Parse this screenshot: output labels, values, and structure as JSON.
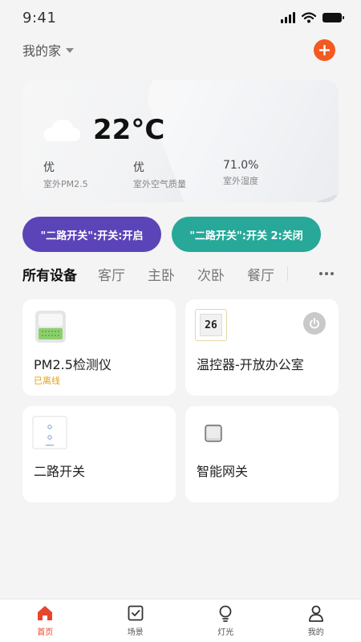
{
  "status_bar": {
    "time": "9:41"
  },
  "header": {
    "home_name": "我的家"
  },
  "weather": {
    "temperature": "22°C",
    "stats": [
      {
        "value": "优",
        "label": "室外PM2.5"
      },
      {
        "value": "优",
        "label": "室外空气质量"
      },
      {
        "value": "71.0%",
        "label": "室外湿度"
      }
    ]
  },
  "scenes": [
    {
      "label": "\"二路开关\":开关:开启",
      "color": "#5b44b8"
    },
    {
      "label": "\"二路开关\":开关 2:关闭",
      "color": "#27a899"
    }
  ],
  "room_tabs": [
    "所有设备",
    "客厅",
    "主卧",
    "次卧",
    "餐厅"
  ],
  "devices": [
    {
      "name": "PM2.5检测仪",
      "status": "已离线",
      "icon": "air-monitor-icon"
    },
    {
      "name": "温控器-开放办公室",
      "status": "",
      "icon": "thermostat-icon",
      "display": "26"
    },
    {
      "name": "二路开关",
      "status": "",
      "icon": "two-way-switch-icon"
    },
    {
      "name": "智能网关",
      "status": "",
      "icon": "gateway-icon"
    }
  ],
  "bottom_nav": [
    {
      "label": "首页",
      "icon": "home-icon",
      "active": true
    },
    {
      "label": "场景",
      "icon": "scene-icon",
      "active": false
    },
    {
      "label": "灯光",
      "icon": "bulb-icon",
      "active": false
    },
    {
      "label": "我的",
      "icon": "user-icon",
      "active": false
    }
  ],
  "colors": {
    "accent": "#e8452c",
    "add_button": "#f25a22",
    "offline": "#e0a21a"
  }
}
